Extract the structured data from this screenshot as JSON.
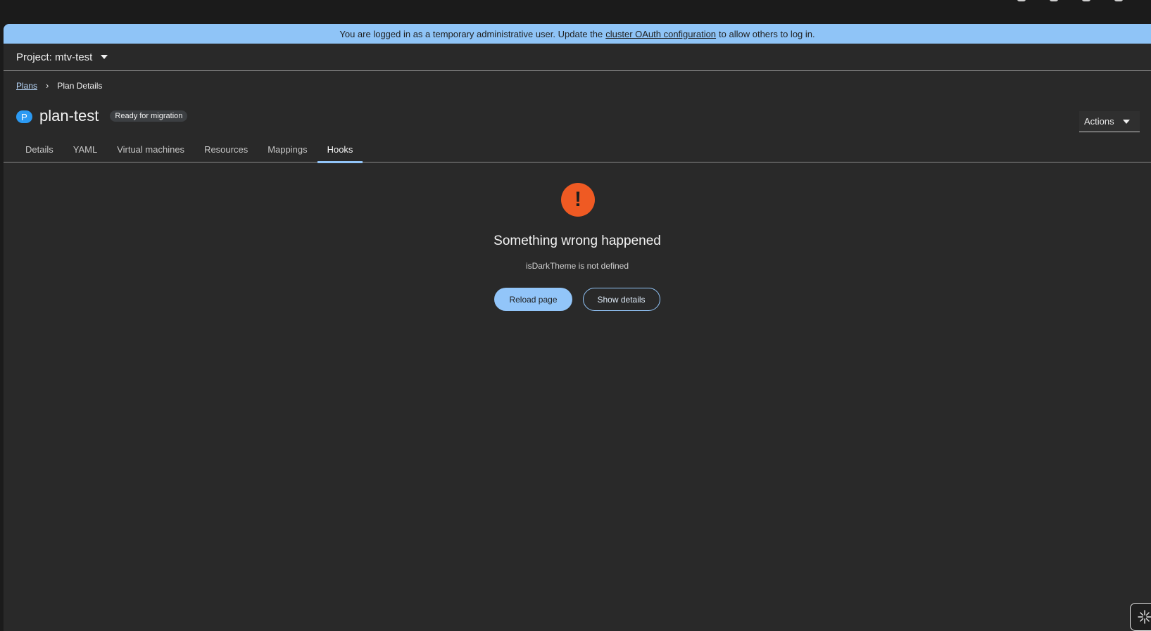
{
  "banner": {
    "text_before": "You are logged in as a temporary administrative user. Update the",
    "link": "cluster OAuth configuration",
    "text_after": "to allow others to log in."
  },
  "project": {
    "label": "Project: mtv-test"
  },
  "breadcrumb": {
    "parent": "Plans",
    "current": "Plan Details"
  },
  "header": {
    "badge": "P",
    "title": "plan-test",
    "status": "Ready for migration",
    "actions_label": "Actions"
  },
  "tabs": [
    {
      "label": "Details"
    },
    {
      "label": "YAML"
    },
    {
      "label": "Virtual machines"
    },
    {
      "label": "Resources"
    },
    {
      "label": "Mappings"
    },
    {
      "label": "Hooks"
    }
  ],
  "active_tab": "Hooks",
  "error": {
    "icon": "exclamation-circle-icon",
    "title": "Something wrong happened",
    "message": "isDarkTheme is not defined",
    "reload_label": "Reload page",
    "details_label": "Show details"
  },
  "colors": {
    "banner": "#8fc4f7",
    "accent": "#92c5f9",
    "danger": "#ef5a23",
    "badge": "#2b9af3"
  }
}
